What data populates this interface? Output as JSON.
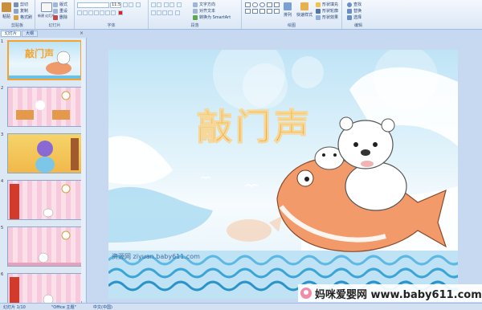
{
  "ribbon": {
    "clipboard": {
      "paste": "粘贴",
      "cut": "剪切",
      "copy": "复制",
      "format": "格式刷",
      "label": "剪贴板"
    },
    "slides": {
      "new_slide": "新建\n幻灯片",
      "layout": "版式",
      "reset": "重设",
      "delete": "删除",
      "label": "幻灯片"
    },
    "font": {
      "font_name": "",
      "font_size": "11.5",
      "label": "字体"
    },
    "paragraph": {
      "text_direction": "文字方向",
      "align_text": "对齐文本",
      "smartart": "转换为 SmartArt",
      "label": "段落"
    },
    "drawing": {
      "arrange": "排列",
      "quick_styles": "快速样式",
      "shape_fill": "形状填充",
      "shape_outline": "形状轮廓",
      "shape_effects": "形状效果",
      "label": "绘图"
    },
    "editing": {
      "find": "查找",
      "replace": "替换",
      "select": "选择",
      "label": "编辑"
    }
  },
  "panel": {
    "tabs": [
      "幻灯片",
      "大纲"
    ],
    "close": "×",
    "thumbnails": [
      {
        "num": "1",
        "title": "敲门声",
        "selected": true
      },
      {
        "num": "2",
        "selected": false
      },
      {
        "num": "3",
        "selected": false
      },
      {
        "num": "4",
        "selected": false
      },
      {
        "num": "5",
        "selected": false
      },
      {
        "num": "6",
        "selected": false
      }
    ]
  },
  "slide": {
    "title": "敲门声",
    "footer_text": "资源网  ziyuan.baby611.com",
    "title_color": "#f2a531"
  },
  "statusbar": {
    "slide_info": "幻灯片 1/10",
    "theme": "\"Office 主题\"",
    "language": "中文(中国)"
  },
  "watermark": {
    "text": "妈咪爱婴网 www.baby611.com"
  }
}
